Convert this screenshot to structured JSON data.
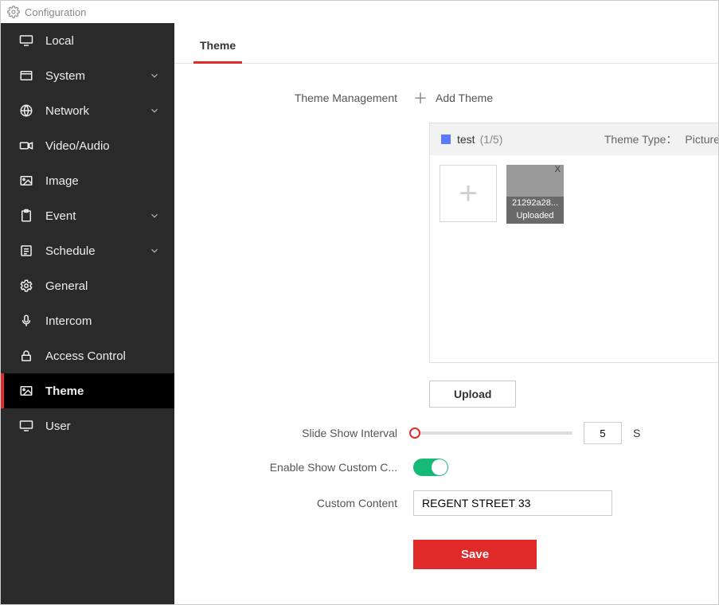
{
  "window": {
    "title": "Configuration"
  },
  "sidebar": {
    "items": [
      {
        "label": "Local",
        "expandable": false,
        "active": false
      },
      {
        "label": "System",
        "expandable": true,
        "active": false
      },
      {
        "label": "Network",
        "expandable": true,
        "active": false
      },
      {
        "label": "Video/Audio",
        "expandable": false,
        "active": false
      },
      {
        "label": "Image",
        "expandable": false,
        "active": false
      },
      {
        "label": "Event",
        "expandable": true,
        "active": false
      },
      {
        "label": "Schedule",
        "expandable": true,
        "active": false
      },
      {
        "label": "General",
        "expandable": false,
        "active": false
      },
      {
        "label": "Intercom",
        "expandable": false,
        "active": false
      },
      {
        "label": "Access Control",
        "expandable": false,
        "active": false
      },
      {
        "label": "Theme",
        "expandable": false,
        "active": true
      },
      {
        "label": "User",
        "expandable": false,
        "active": false
      }
    ]
  },
  "tabs": {
    "theme": "Theme"
  },
  "labels": {
    "theme_management": "Theme Management",
    "add_theme": "Add Theme",
    "theme_type": "Theme Type：",
    "upload": "Upload",
    "slide_show_interval": "Slide Show Interval",
    "seconds_suffix": "S",
    "enable_show_custom": "Enable Show Custom C...",
    "custom_content": "Custom Content",
    "save": "Save"
  },
  "theme_panel": {
    "name": "test",
    "count": "(1/5)",
    "type": "Picture",
    "file": {
      "name": "21292a28...",
      "status": "Uploaded"
    }
  },
  "form": {
    "interval": "5",
    "enable_custom": true,
    "custom_content": "REGENT STREET 33"
  }
}
